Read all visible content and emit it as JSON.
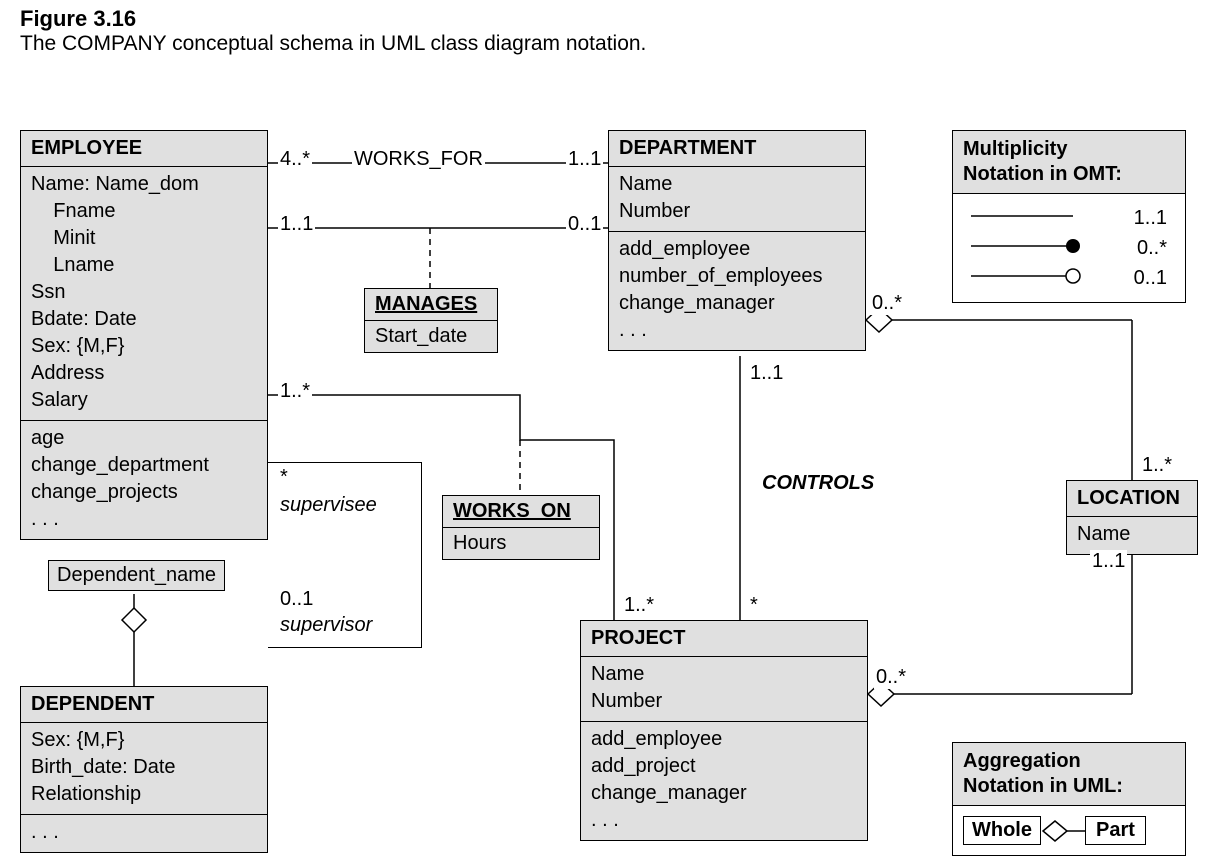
{
  "figure": {
    "num": "Figure 3.16",
    "caption": "The COMPANY conceptual schema in UML class diagram notation."
  },
  "employee": {
    "title": "EMPLOYEE",
    "attrs": "Name: Name_dom\n    Fname\n    Minit\n    Lname\nSsn\nBdate: Date\nSex: {M,F}\nAddress\nSalary",
    "ops": "age\nchange_department\nchange_projects\n. . ."
  },
  "department": {
    "title": "DEPARTMENT",
    "attrs": "Name\nNumber",
    "ops": "add_employee\nnumber_of_employees\nchange_manager\n. . ."
  },
  "project": {
    "title": "PROJECT",
    "attrs": "Name\nNumber",
    "ops": "add_employee\nadd_project\nchange_manager\n. . ."
  },
  "dependent": {
    "title": "DEPENDENT",
    "attrs": "Sex: {M,F}\nBirth_date: Date\nRelationship",
    "ops": ". . ."
  },
  "location": {
    "title": "LOCATION",
    "attr": "Name"
  },
  "manages": {
    "title": "MANAGES",
    "attr": "Start_date"
  },
  "works_on": {
    "title": "WORKS_ON",
    "attr": "Hours"
  },
  "qualifier": "Dependent_name",
  "assoc": {
    "works_for": "WORKS_FOR",
    "controls": "CONTROLS",
    "supervisee": "supervisee",
    "supervisor": "supervisor"
  },
  "mult": {
    "wf_emp": "4..*",
    "wf_dept": "1..1",
    "mg_emp": "1..1",
    "mg_dept": "0..1",
    "wo_emp": "1..*",
    "wo_proj": "1..*",
    "sup_up": "*",
    "sup_dn": "0..1",
    "ctrl_dept": "1..1",
    "ctrl_proj": "*",
    "deptloc_dept": "0..*",
    "deptloc_loc": "1..*",
    "projloc_proj": "0..*",
    "projloc_loc": "1..1"
  },
  "legend_omt": {
    "title": "Multiplicity\nNotation in OMT:",
    "l1": "1..1",
    "l2": "0..*",
    "l3": "0..1"
  },
  "legend_agg": {
    "title": "Aggregation\nNotation in UML:",
    "whole": "Whole",
    "part": "Part"
  }
}
